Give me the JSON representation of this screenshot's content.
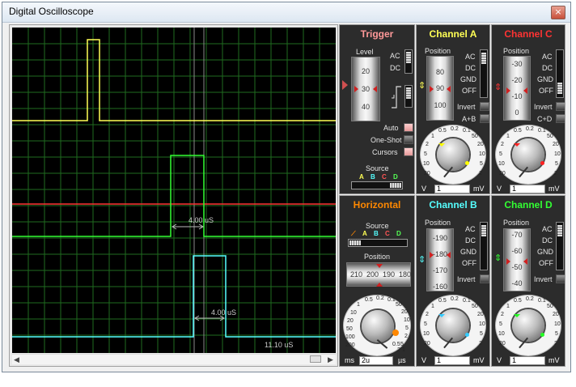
{
  "window": {
    "title": "Digital Oscilloscope",
    "close_glyph": "×"
  },
  "screen": {
    "marker_a": "4.00 uS",
    "marker_b": "4.00 uS",
    "time_readout": "11.10 uS"
  },
  "trigger": {
    "title": "Trigger",
    "level_label": "Level",
    "level_scale": [
      "20",
      "30",
      "40"
    ],
    "ac_label": "AC",
    "dc_label": "DC",
    "auto_label": "Auto",
    "oneshot_label": "One-Shot",
    "cursors_label": "Cursors",
    "source_label": "Source",
    "source_letters": [
      "A",
      "B",
      "C",
      "D"
    ]
  },
  "channel_a": {
    "title": "Channel A",
    "position_label": "Position",
    "scale": [
      "80",
      "90",
      "100"
    ],
    "coupling": [
      "AC",
      "DC",
      "GND",
      "OFF"
    ],
    "invert_label": "Invert",
    "combine_label": "A+B",
    "dial_numbers": [
      "0.5",
      "0.2",
      "0.1",
      "50",
      "20",
      "10",
      "5",
      "2",
      "1",
      "2",
      "5",
      "10",
      "20"
    ],
    "left_unit": "V",
    "value": "1",
    "right_unit": "mV"
  },
  "channel_c": {
    "title": "Channel C",
    "position_label": "Position",
    "scale": [
      "-30",
      "-20",
      "-10",
      "0"
    ],
    "coupling": [
      "AC",
      "DC",
      "GND",
      "OFF"
    ],
    "invert_label": "Invert",
    "combine_label": "C+D",
    "dial_numbers": [
      "0.5",
      "0.2",
      "0.1",
      "50",
      "20",
      "10",
      "5",
      "2",
      "1",
      "2",
      "5",
      "10",
      "20"
    ],
    "left_unit": "V",
    "value": "1",
    "right_unit": "mV"
  },
  "horizontal": {
    "title": "Horizontal",
    "source_label": "Source",
    "source_letters": [
      "A",
      "B",
      "C",
      "D"
    ],
    "position_label": "Position",
    "scale": [
      "210",
      "200",
      "190",
      "180"
    ],
    "dial_numbers": [
      "0.5",
      "0.2",
      "0.1",
      "50",
      "20",
      "10",
      "5",
      "2",
      "1",
      "200",
      "100",
      "50",
      "20",
      "10",
      "5",
      "2",
      "1",
      "0.5"
    ],
    "left_unit": "ms",
    "value": "2u",
    "right_unit": "µs"
  },
  "channel_b": {
    "title": "Channel B",
    "position_label": "Position",
    "scale": [
      "-190",
      "-180",
      "-170",
      "-160"
    ],
    "coupling": [
      "AC",
      "DC",
      "GND",
      "OFF"
    ],
    "invert_label": "Invert",
    "dial_numbers": [
      "0.5",
      "0.2",
      "0.1",
      "50",
      "20",
      "10",
      "5",
      "2",
      "1",
      "2",
      "5",
      "10",
      "20"
    ],
    "left_unit": "V",
    "value": "1",
    "right_unit": "mV"
  },
  "channel_d": {
    "title": "Channel D",
    "position_label": "Position",
    "scale": [
      "-70",
      "-60",
      "-50",
      "-40"
    ],
    "coupling": [
      "AC",
      "DC",
      "GND",
      "OFF"
    ],
    "invert_label": "Invert",
    "dial_numbers": [
      "0.5",
      "0.2",
      "0.1",
      "50",
      "20",
      "10",
      "5",
      "2",
      "1",
      "2",
      "5",
      "10",
      "20"
    ],
    "left_unit": "V",
    "value": "1",
    "right_unit": "mV"
  },
  "colors": {
    "channel_a": "#ffff55",
    "channel_b": "#55ffff",
    "channel_c": "#ff3333",
    "channel_d": "#33ff33",
    "trigger_title": "#ff9999",
    "horizontal_title": "#ff8800",
    "grid": "#1f6b1f",
    "screen_bg": "#000000"
  }
}
